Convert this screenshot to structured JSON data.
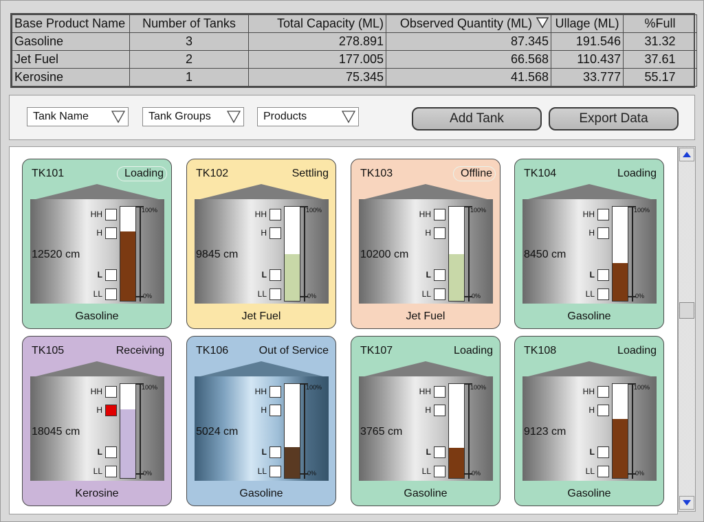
{
  "summary": {
    "headers": [
      "Base Product Name",
      "Number of Tanks",
      "Total Capacity (ML)",
      "Observed Quantity (ML)",
      "Ullage (ML)",
      "%Full"
    ],
    "rows": [
      [
        "Gasoline",
        "3",
        "278.891",
        "87.345",
        "191.546",
        "31.32"
      ],
      [
        "Jet Fuel",
        "2",
        "177.005",
        "66.568",
        "110.437",
        "37.61"
      ],
      [
        "Kerosine",
        "1",
        "75.345",
        "41.568",
        "33.777",
        "55.17"
      ]
    ]
  },
  "toolbar": {
    "tank_name": "Tank Name",
    "tank_groups": "Tank Groups",
    "products": "Products",
    "add_tank": "Add Tank",
    "export_data": "Export Data"
  },
  "gauge_labels": {
    "top": "100%",
    "bottom": "0%"
  },
  "alarm_labels": [
    "HH",
    "H",
    "L",
    "LL"
  ],
  "colors": {
    "card_green": "#a9dcc2",
    "card_yellow": "#fbe6a8",
    "card_peach": "#f8d5be",
    "card_purple": "#cbb5d9",
    "card_blue": "#a8c6e0",
    "fill_brown": "#7b3a12",
    "fill_sage": "#c8d8a8",
    "fill_lavender": "#c7b7dc",
    "fill_darkbrown": "#5a3a22",
    "alarm_red": "#e00000"
  },
  "tanks": [
    {
      "name": "TK101",
      "status": "Loading",
      "level": "12520 cm",
      "product": "Gasoline",
      "fill": 0.74,
      "card": "card_green",
      "fillColor": "fill_brown",
      "alarm_h": false,
      "tint": false,
      "pill": true
    },
    {
      "name": "TK102",
      "status": "Settling",
      "level": "9845 cm",
      "product": "Jet Fuel",
      "fill": 0.5,
      "card": "card_yellow",
      "fillColor": "fill_sage",
      "alarm_h": false,
      "tint": false,
      "pill": false
    },
    {
      "name": "TK103",
      "status": "Offline",
      "level": "10200 cm",
      "product": "Jet Fuel",
      "fill": 0.5,
      "card": "card_peach",
      "fillColor": "fill_sage",
      "alarm_h": false,
      "tint": false,
      "pill": true
    },
    {
      "name": "TK104",
      "status": "Loading",
      "level": "8450 cm",
      "product": "Gasoline",
      "fill": 0.4,
      "card": "card_green",
      "fillColor": "fill_brown",
      "alarm_h": false,
      "tint": false,
      "pill": false
    },
    {
      "name": "TK105",
      "status": "Receiving",
      "level": "18045 cm",
      "product": "Kerosine",
      "fill": 0.73,
      "card": "card_purple",
      "fillColor": "fill_lavender",
      "alarm_h": true,
      "tint": false,
      "pill": false
    },
    {
      "name": "TK106",
      "status": "Out of Service",
      "level": "5024 cm",
      "product": "Gasoline",
      "fill": 0.33,
      "card": "card_blue",
      "fillColor": "fill_darkbrown",
      "alarm_h": false,
      "tint": true,
      "pill": false
    },
    {
      "name": "TK107",
      "status": "Loading",
      "level": "3765 cm",
      "product": "Gasoline",
      "fill": 0.32,
      "card": "card_green",
      "fillColor": "fill_brown",
      "alarm_h": false,
      "tint": false,
      "pill": false
    },
    {
      "name": "TK108",
      "status": "Loading",
      "level": "9123 cm",
      "product": "Gasoline",
      "fill": 0.63,
      "card": "card_green",
      "fillColor": "fill_brown",
      "alarm_h": false,
      "tint": false,
      "pill": false
    }
  ]
}
